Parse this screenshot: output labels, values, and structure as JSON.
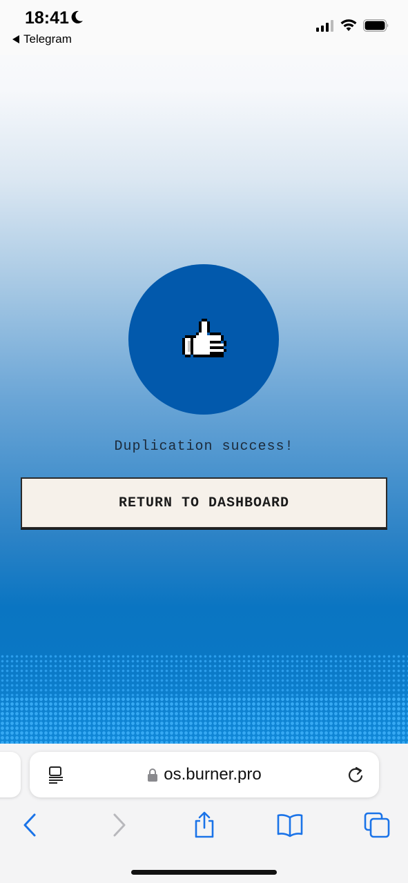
{
  "status_bar": {
    "time": "18:41",
    "back_app": "Telegram"
  },
  "main": {
    "icon": "thumbs-up-icon",
    "message": "Duplication success!",
    "return_button": "RETURN TO DASHBOARD"
  },
  "browser": {
    "url": "os.burner.pro"
  },
  "colors": {
    "circle": "#0259ac",
    "button_bg": "#f6f1ea",
    "accent_blue": "#1a73e8"
  }
}
